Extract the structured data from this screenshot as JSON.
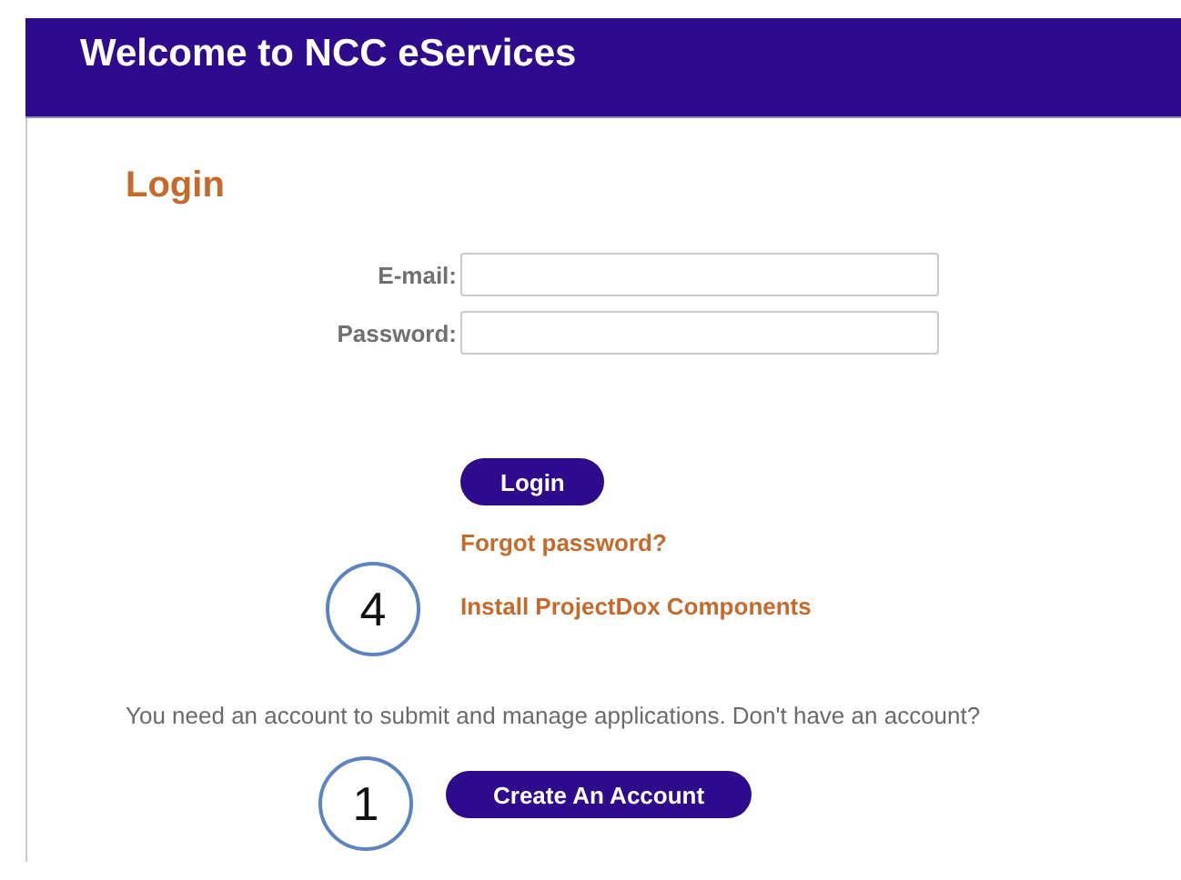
{
  "header": {
    "title": "Welcome to NCC eServices"
  },
  "login": {
    "heading": "Login",
    "fields": [
      {
        "label": "E-mail:"
      },
      {
        "label": "Password:"
      }
    ],
    "submit": "Login",
    "links": [
      {
        "text": "Forgot password?"
      },
      {
        "text": "Install ProjectDox Components",
        "callout": "4"
      }
    ]
  },
  "signup": {
    "message": "You need an account to submit and manage applications. Don't have an account?",
    "button": "Create An Account",
    "callout": "1"
  }
}
